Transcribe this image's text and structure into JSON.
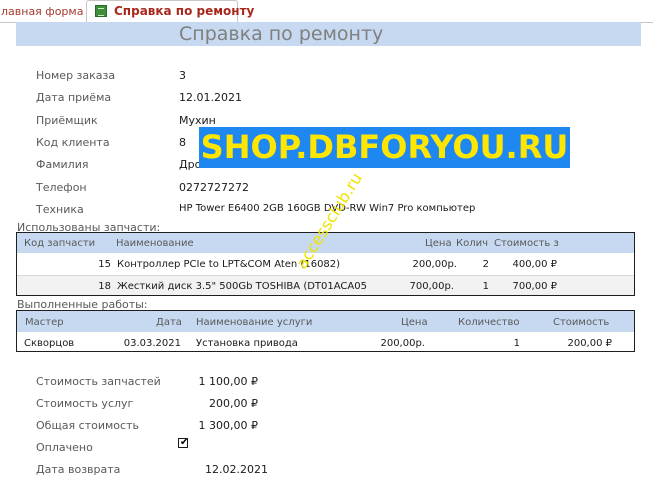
{
  "tabs": [
    {
      "label": "лавная форма"
    },
    {
      "label": "Справка по ремонту"
    }
  ],
  "title": "Справка по ремонту",
  "fields": {
    "order_no": {
      "label": "Номер заказа",
      "value": "3"
    },
    "date_received": {
      "label": "Дата приёма",
      "value": "12.01.2021"
    },
    "receiver": {
      "label": "Приёмщик",
      "value": "Мухин"
    },
    "client_code": {
      "label": "Код клиента",
      "value": "8"
    },
    "surname": {
      "label": "Фамилия",
      "value": "Дро"
    },
    "phone": {
      "label": "Телефон",
      "value": "0272727272"
    },
    "equipment": {
      "label": "Техника",
      "value": "HP Tower E6400 2GB 160GB DVD-RW Win7 Pro компьютер"
    }
  },
  "parts": {
    "section_label": "Использованы запчасти:",
    "headers": {
      "code": "Код запчасти",
      "name": "Наименование",
      "price": "Цена",
      "qty": "Колич",
      "cost": "Стоимость з"
    },
    "rows": [
      {
        "code": "15",
        "name": "Контроллер PCIe to LPT&COM Aten (16082)",
        "price": "200,00р.",
        "qty": "2",
        "cost": "400,00 ₽"
      },
      {
        "code": "18",
        "name": "Жесткий диск 3.5\" 500Gb TOSHIBA (DT01ACA05",
        "price": "700,00р.",
        "qty": "1",
        "cost": "700,00 ₽"
      }
    ]
  },
  "works": {
    "section_label": "Выполненные работы:",
    "headers": {
      "master": "Мастер",
      "date": "Дата",
      "service": "Наименование услуги",
      "price": "Цена",
      "qty": "Количество",
      "cost": "Стоимость"
    },
    "rows": [
      {
        "master": "Скворцов",
        "date": "03.03.2021",
        "service": "Установка привода",
        "price": "200,00р.",
        "qty": "1",
        "cost": "200,00 ₽"
      }
    ]
  },
  "totals": {
    "parts_cost": {
      "label": "Стоимость запчастей",
      "value": "1 100,00 ₽"
    },
    "services_cost": {
      "label": "Стоимость услуг",
      "value": "200,00 ₽"
    },
    "total_cost": {
      "label": "Общая стоимость",
      "value": "1 300,00 ₽"
    },
    "paid": {
      "label": "Оплачено",
      "checked": true
    },
    "return_date": {
      "label": "Дата возврата",
      "value": "12.02.2021"
    }
  },
  "watermarks": {
    "banner": "SHOP.DBFORYOU.RU",
    "diagonal": "accessclub.ru"
  },
  "colors": {
    "header_band": "#c6d9f0",
    "tab_text": "#a8291b",
    "watermark_bg": "#1e88f0",
    "watermark_text": "#ffe600"
  }
}
